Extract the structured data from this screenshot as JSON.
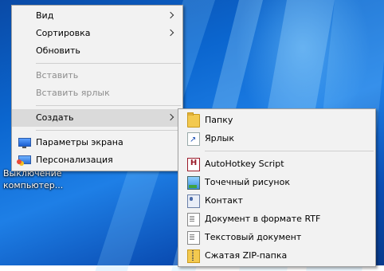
{
  "desktop": {
    "icon_label": "Выключение компьютер..."
  },
  "context_menu": {
    "items": [
      {
        "label": "Вид",
        "has_submenu": true
      },
      {
        "label": "Сортировка",
        "has_submenu": true
      },
      {
        "label": "Обновить"
      },
      {
        "label": "Вставить",
        "disabled": true
      },
      {
        "label": "Вставить ярлык",
        "disabled": true
      },
      {
        "label": "Создать",
        "has_submenu": true,
        "highlighted": true
      },
      {
        "label": "Параметры экрана",
        "icon": "monitor-icon"
      },
      {
        "label": "Персонализация",
        "icon": "personalize-icon"
      }
    ]
  },
  "create_submenu": {
    "items": [
      {
        "label": "Папку",
        "icon": "folder-icon"
      },
      {
        "label": "Ярлык",
        "icon": "shortcut-icon"
      },
      {
        "label": "AutoHotkey Script",
        "icon": "autohotkey-icon",
        "icon_glyph": "H"
      },
      {
        "label": "Точечный рисунок",
        "icon": "bitmap-icon"
      },
      {
        "label": "Контакт",
        "icon": "contact-icon"
      },
      {
        "label": "Документ в формате RTF",
        "icon": "rtf-document-icon"
      },
      {
        "label": "Текстовый документ",
        "icon": "text-document-icon"
      },
      {
        "label": "Сжатая ZIP-папка",
        "icon": "zip-folder-icon"
      }
    ]
  },
  "colors": {
    "menu_bg": "#f2f2f2",
    "highlight": "#dadada",
    "disabled_text": "#8d8d8d",
    "desktop_blue": "#0b66cf"
  }
}
